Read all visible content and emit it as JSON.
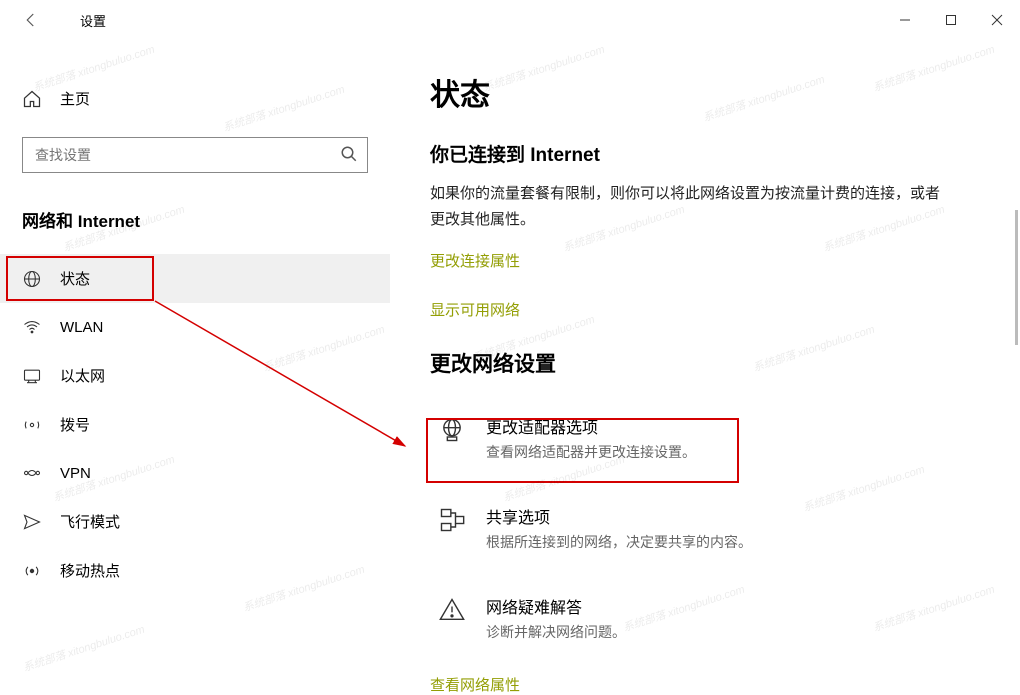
{
  "titlebar": {
    "title": "设置"
  },
  "sidebar": {
    "home": "主页",
    "search_placeholder": "查找设置",
    "section": "网络和 Internet",
    "items": [
      {
        "label": "状态"
      },
      {
        "label": "WLAN"
      },
      {
        "label": "以太网"
      },
      {
        "label": "拨号"
      },
      {
        "label": "VPN"
      },
      {
        "label": "飞行模式"
      },
      {
        "label": "移动热点"
      }
    ]
  },
  "main": {
    "title": "状态",
    "connected_heading": "你已连接到 Internet",
    "connected_body": "如果你的流量套餐有限制，则你可以将此网络设置为按流量计费的连接，或者更改其他属性。",
    "link_change_props": "更改连接属性",
    "link_show_networks": "显示可用网络",
    "change_section": "更改网络设置",
    "items": [
      {
        "title": "更改适配器选项",
        "desc": "查看网络适配器并更改连接设置。"
      },
      {
        "title": "共享选项",
        "desc": "根据所连接到的网络，决定要共享的内容。"
      },
      {
        "title": "网络疑难解答",
        "desc": "诊断并解决网络问题。"
      }
    ],
    "link_view_props": "查看网络属性"
  },
  "watermark": "系统部落 xitongbuluo.com"
}
